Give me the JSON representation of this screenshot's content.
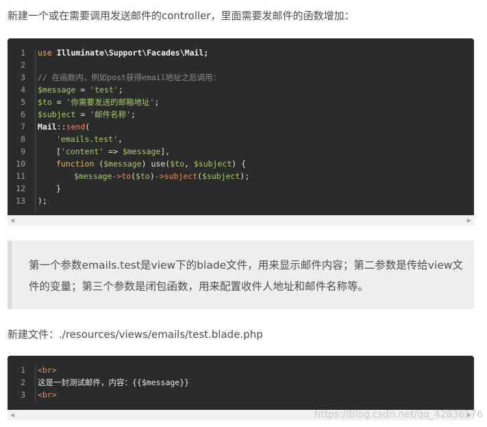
{
  "intro": "新建一个或在需要调用发送邮件的controller，里面需要发邮件的函数增加：",
  "code1": {
    "lines": [
      "1",
      "2",
      "3",
      "4",
      "5",
      "6",
      "7",
      "8",
      "9",
      "10",
      "11",
      "12",
      "13"
    ],
    "l1_kw": "use",
    "l1_rest": " Illuminate\\Support\\Facades\\Mail;",
    "l3": "// 在函数内，例如post获得email地址之后调用：",
    "l4_var": "$message",
    "l4_op": " = ",
    "l4_str": "'test'",
    "l4_end": ";",
    "l5_var": "$to",
    "l5_op": " = ",
    "l5_str": "'你需要发送的邮箱地址'",
    "l5_end": ";",
    "l6_var": "$subject",
    "l6_op": " = ",
    "l6_str": "'邮件名称'",
    "l6_end": ";",
    "l7_cls": "Mail",
    "l7_op": "::",
    "l7_fn": "send",
    "l7_end": "(",
    "l8_str": "'emails.test'",
    "l8_end": ",",
    "l9_a": "[",
    "l9_str": "'content'",
    "l9_op": " => ",
    "l9_var": "$message",
    "l9_end": "],",
    "l10_kw": "function",
    "l10_a": " (",
    "l10_var": "$message",
    "l10_b": ") ",
    "l10_use": "use",
    "l10_c": "(",
    "l10_v2": "$to",
    "l10_d": ", ",
    "l10_v3": "$subject",
    "l10_e": ") {",
    "l11_var": "$message",
    "l11_op": "->",
    "l11_fn": "to",
    "l11_a": "(",
    "l11_v2": "$to",
    "l11_b": ")",
    "l11_op2": "->",
    "l11_fn2": "subject",
    "l11_c": "(",
    "l11_v3": "$subject",
    "l11_d": ");",
    "l12": "}",
    "l13": ");"
  },
  "quote": {
    "line1": "第一个参数emails.test是view下的blade文件，用来显示邮件内容；第二参数是传给view文",
    "line2": "件的变量；第三个参数是闭包函数，用来配置收件人地址和邮件名称等。"
  },
  "newfile": "新建文件：./resources/views/emails/test.blade.php",
  "code2": {
    "lines": [
      "1",
      "2",
      "3"
    ],
    "l1": "<br>",
    "l2_text": "这是一封测试邮件，内容：",
    "l2_var": "{{$message}}",
    "l3": "<br>"
  },
  "watermark": "https://blog.csdn.net/qq_42836576"
}
